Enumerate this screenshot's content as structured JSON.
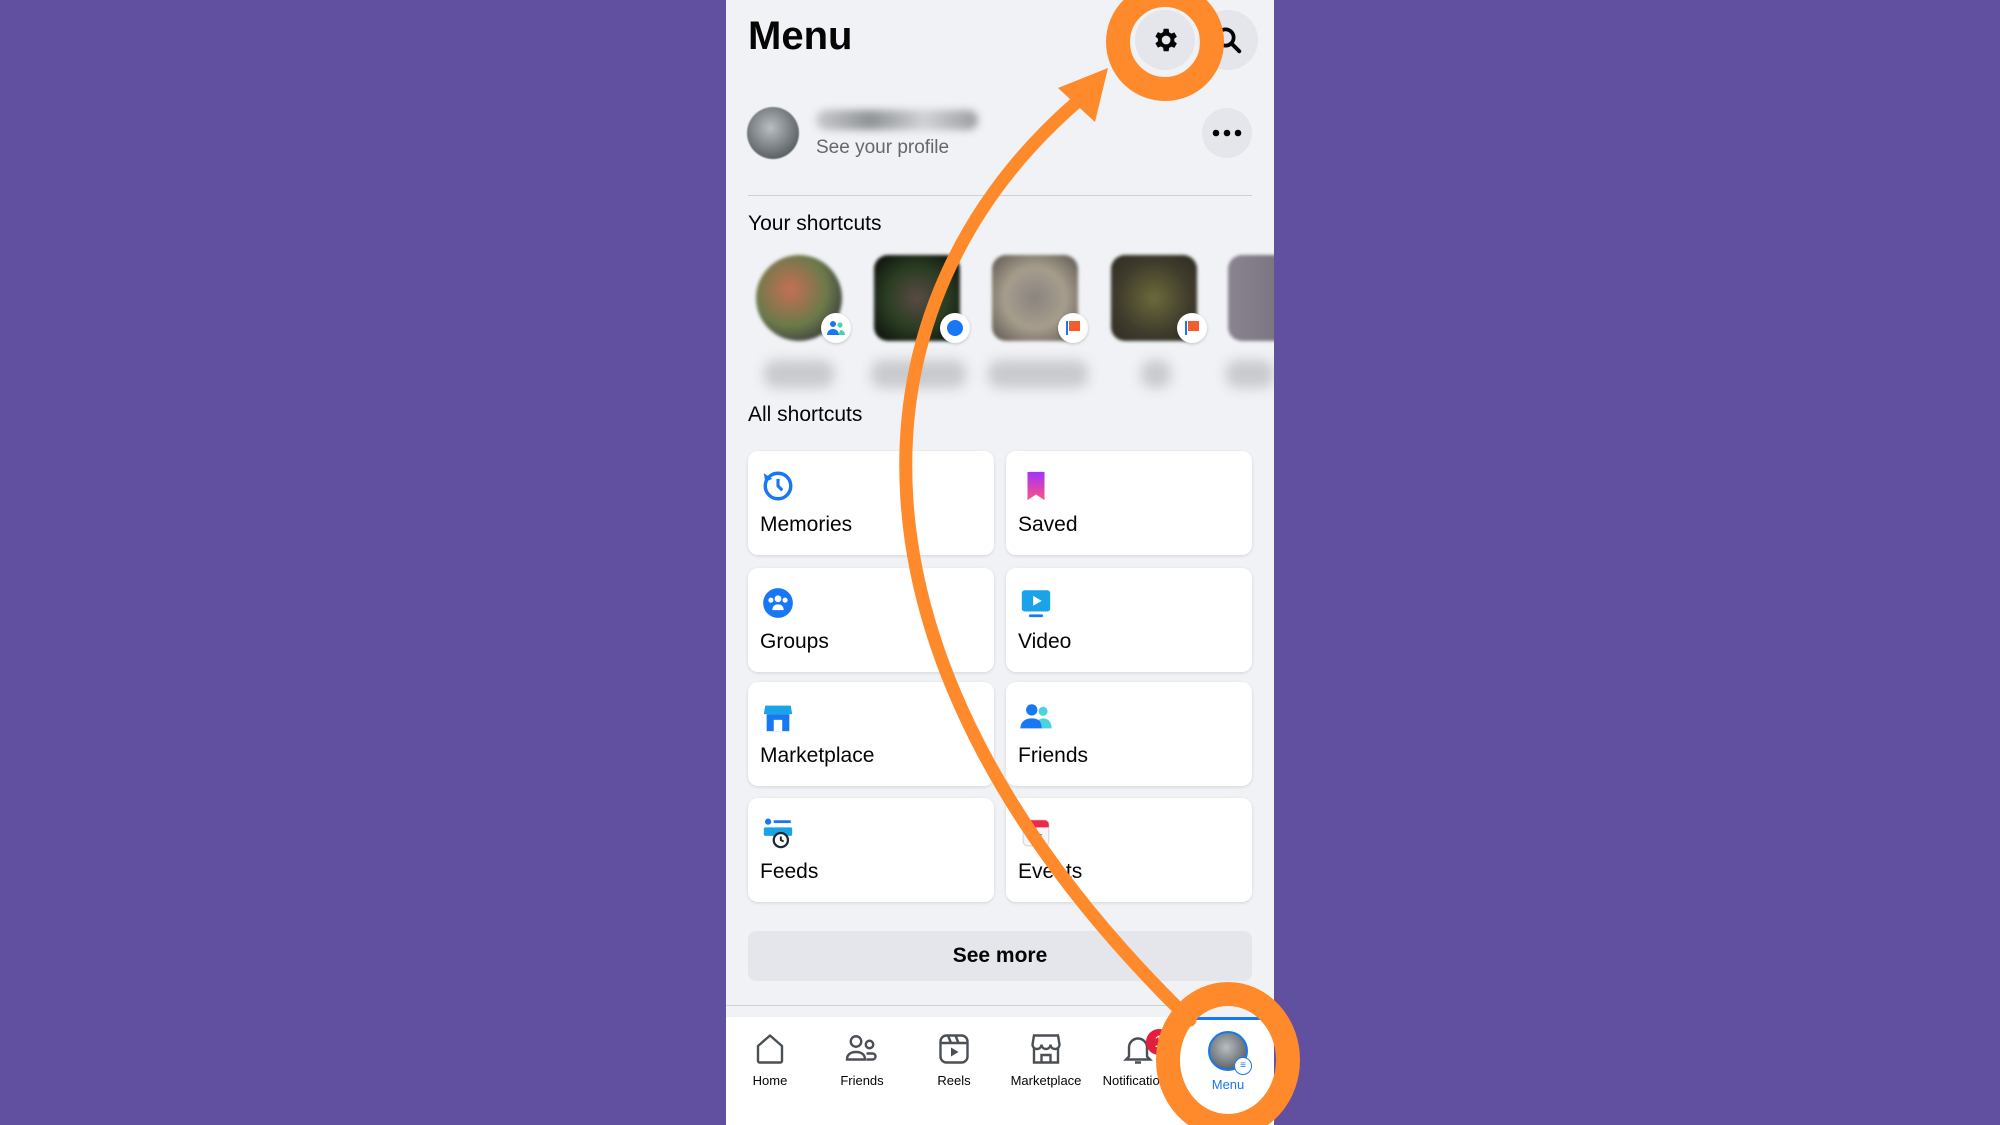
{
  "header": {
    "title": "Menu",
    "icons": [
      "gear-icon",
      "search-icon"
    ]
  },
  "profile": {
    "see_profile": "See your profile"
  },
  "shortcuts": {
    "title": "Your shortcuts"
  },
  "all_shortcuts": {
    "title": "All shortcuts",
    "items": [
      {
        "label": "Memories",
        "icon": "clock-icon"
      },
      {
        "label": "Saved",
        "icon": "bookmark-icon"
      },
      {
        "label": "Groups",
        "icon": "groups-icon"
      },
      {
        "label": "Video",
        "icon": "video-icon"
      },
      {
        "label": "Marketplace",
        "icon": "shop-icon"
      },
      {
        "label": "Friends",
        "icon": "friends-icon"
      },
      {
        "label": "Feeds",
        "icon": "feeds-icon"
      },
      {
        "label": "Events",
        "icon": "calendar-icon"
      }
    ]
  },
  "see_more": "See more",
  "nav": {
    "tabs": [
      {
        "label": "Home"
      },
      {
        "label": "Friends"
      },
      {
        "label": "Reels"
      },
      {
        "label": "Marketplace"
      },
      {
        "label": "Notifications",
        "badge": "1"
      },
      {
        "label": "Menu",
        "active": true
      }
    ]
  },
  "colors": {
    "background": "#6150a0",
    "annotation": "#ff8a2b",
    "accent": "#1877f2",
    "badge": "#e41e3f"
  }
}
